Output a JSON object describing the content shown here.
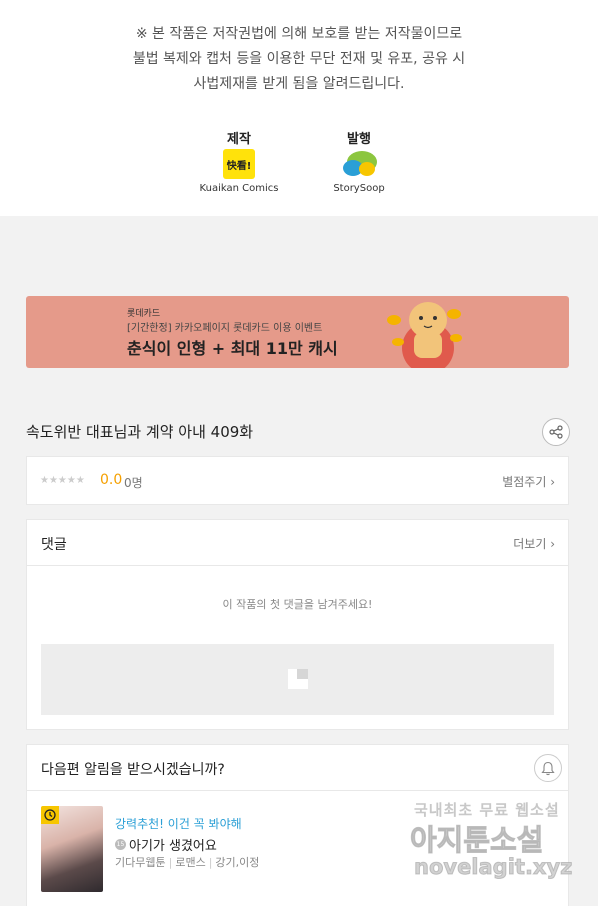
{
  "copyright": {
    "line1": "※ 본 작품은 저작권법에 의해 보호를 받는 저작물이므로",
    "line2": "불법 복제와 캡처 등을  이용한 무단 전재 및 유포, 공유 시",
    "line3": "사법제재를  받게 됨을 알려드립니다."
  },
  "credits": {
    "production_label": "제작",
    "production_logo_text": "快看!",
    "production_name": "Kuaikan Comics",
    "publisher_label": "발행",
    "publisher_name": "StorySoop"
  },
  "banner": {
    "brand": "롯데카드",
    "subtitle": "[기간한정] 카카오페이지 롯데카드 이용 이벤트",
    "title": "춘식이 인형 + 최대 11만 캐시",
    "colors": {
      "background": "#e59a8a"
    }
  },
  "episode": {
    "title": "속도위반 대표님과 계약 아내 409화",
    "share_icon": "share-icon"
  },
  "rating": {
    "stars": "★★★★★",
    "score": "0.0",
    "count": "0명",
    "rate_link": "별점주기 ›"
  },
  "comments": {
    "title": "댓글",
    "more_link": "더보기 ›",
    "empty_message": "이 작품의 첫 댓글을 남겨주세요!"
  },
  "next_alarm": {
    "question": "다음편 알림을 받으시겠습니까?",
    "bell_icon": "bell-icon"
  },
  "recommendation": {
    "label": "강력추천! 이건 꼭 봐야해",
    "age_badge": "15",
    "title": "아기가 생겼어요",
    "genre1": "기다무웹툰",
    "genre2": "로맨스",
    "authors": "강기,이정"
  },
  "watermark": {
    "line1": "국내최초 무료 웹소설",
    "line2": "아지툰소설",
    "line3": "novelagit.xyz"
  }
}
